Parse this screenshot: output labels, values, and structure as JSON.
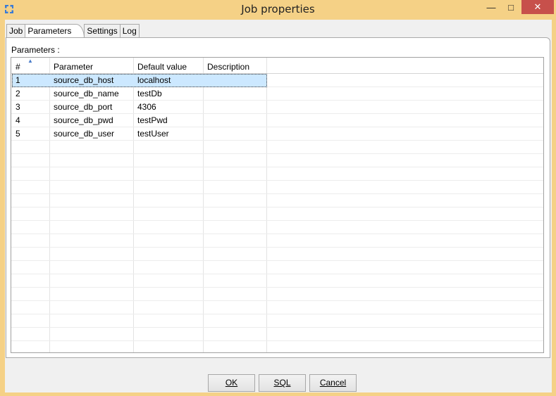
{
  "window": {
    "title": "Job properties"
  },
  "tabs": [
    {
      "label": "Job",
      "active": false
    },
    {
      "label": "Parameters",
      "active": true
    },
    {
      "label": "Settings",
      "active": false
    },
    {
      "label": "Log",
      "active": false
    }
  ],
  "parameters_label": "Parameters :",
  "table": {
    "columns": [
      "#",
      "Parameter",
      "Default value",
      "Description"
    ],
    "rows": [
      {
        "num": "1",
        "parameter": "source_db_host",
        "default_value": "localhost",
        "description": ""
      },
      {
        "num": "2",
        "parameter": "source_db_name",
        "default_value": "testDb",
        "description": ""
      },
      {
        "num": "3",
        "parameter": "source_db_port",
        "default_value": "4306",
        "description": ""
      },
      {
        "num": "4",
        "parameter": "source_db_pwd",
        "default_value": "testPwd",
        "description": ""
      },
      {
        "num": "5",
        "parameter": "source_db_user",
        "default_value": "testUser",
        "description": ""
      }
    ],
    "selected_row": 0
  },
  "buttons": {
    "ok": "OK",
    "sql": "SQL",
    "cancel": "Cancel"
  },
  "colors": {
    "title_bar": "#f5d186",
    "close_button": "#c7504b",
    "selection": "#cce8ff"
  }
}
